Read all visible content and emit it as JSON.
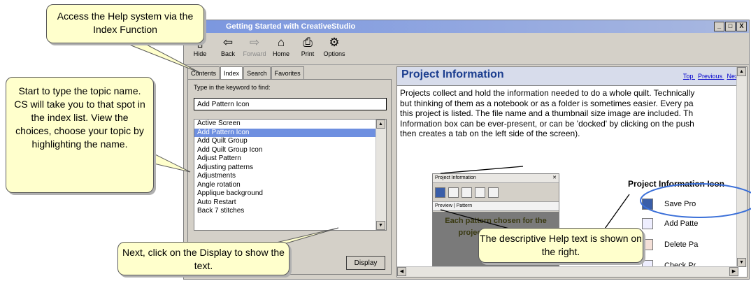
{
  "window": {
    "title": "Getting Started with CreativeStudio",
    "controls": [
      "_",
      "□",
      "X"
    ]
  },
  "toolbar": {
    "buttons": [
      {
        "label": "Hide",
        "icon": "hide-icon"
      },
      {
        "label": "Back",
        "icon": "back-arrow-icon"
      },
      {
        "label": "Forward",
        "icon": "forward-arrow-icon"
      },
      {
        "label": "Home",
        "icon": "home-icon"
      },
      {
        "label": "Print",
        "icon": "print-icon"
      },
      {
        "label": "Options",
        "icon": "options-icon"
      }
    ]
  },
  "tabs": [
    "Contents",
    "Index",
    "Search",
    "Favorites"
  ],
  "index": {
    "prompt": "Type in the keyword to find:",
    "keyword": "Add Pattern Icon",
    "items": [
      "Active Screen",
      "Add Pattern Icon",
      "Add Quilt Group",
      "Add Quilt Group Icon",
      "Adjust Pattern",
      "Adjusting patterns",
      "Adjustments",
      "Angle rotation",
      "Applique background",
      "Auto Restart",
      "Back 7 stitches"
    ],
    "display_label": "Display"
  },
  "topic": {
    "title": "Project Information",
    "links": [
      "Top",
      "Previous",
      "Next"
    ],
    "lines": [
      "Projects collect and hold the information needed to do a whole quilt. Technically",
      "but thinking of them as a notebook or as a folder is sometimes easier. Every pa",
      "this project is listed. The file name and a thumbnail size image are included. Th",
      "Information box can be ever-present, or can be 'docked' by clicking on the push",
      "then creates a tab on the left side of the screen)."
    ],
    "mini_title": "Project Information",
    "mini_tabs": "Preview | Pattern",
    "mini_text": "Each pattern chosen for the project is listed here",
    "icons_heading": "Project Information Icon",
    "icon_items": [
      "Save Pro",
      "Add Patte",
      "Delete Pa",
      "Check Pr"
    ]
  },
  "callouts": {
    "index": "Access the Help system via the Index Function",
    "type": "Start to type the topic name. CS will take you to that spot in the index list. View the choices, choose your topic by highlighting the name.",
    "display": "Next, click on the Display to show the text.",
    "right": "The descriptive Help text is shown on the right."
  },
  "colors": {
    "title_text": "#1c3e8f",
    "selection": "#6e8fe0",
    "callout_bg": "#ffffcc",
    "highlight_ring": "#3a6fd8"
  }
}
